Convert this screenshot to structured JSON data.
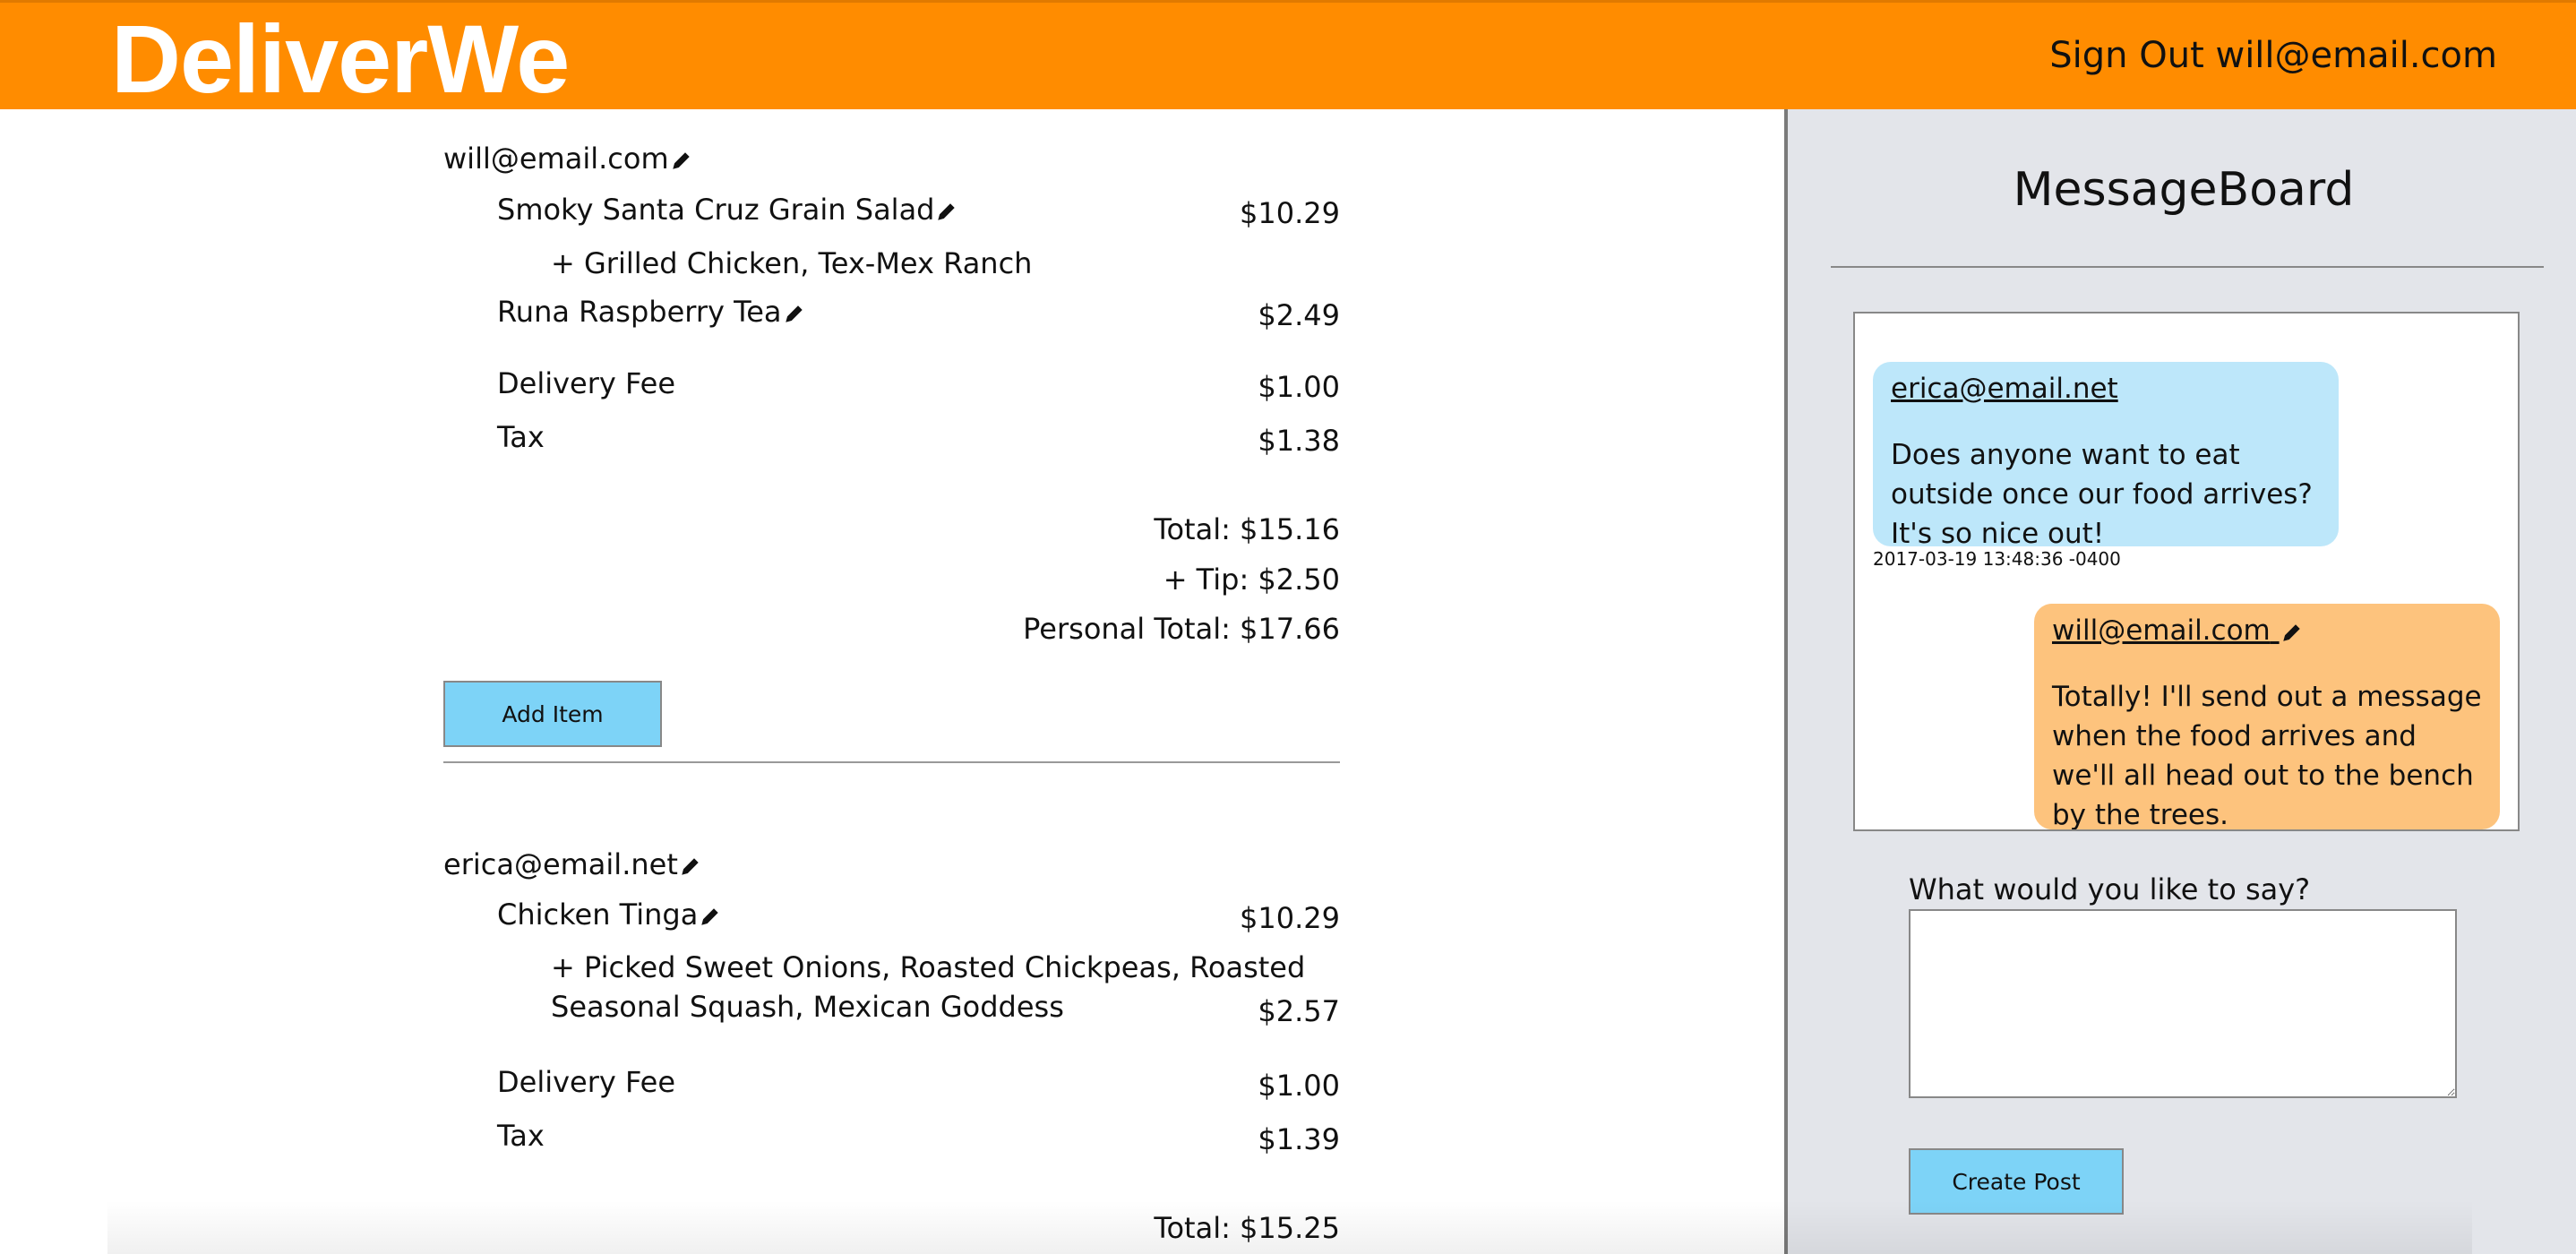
{
  "header": {
    "logo": "DeliverWe",
    "signout_label": "Sign Out will@email.com"
  },
  "orders": [
    {
      "user": "will@email.com",
      "items": [
        {
          "name": "Smoky Santa Cruz Grain Salad",
          "price": "$10.29",
          "mods": "+ Grilled Chicken, Tex-Mex Ranch"
        },
        {
          "name": "Runa Raspberry Tea",
          "price": "$2.49"
        }
      ],
      "delivery_label": "Delivery Fee",
      "delivery_fee": "$1.00",
      "tax_label": "Tax",
      "tax": "$1.38",
      "total": "Total: $15.16",
      "tip": "+ Tip: $2.50",
      "personal_total": "Personal Total: $17.66",
      "add_item_label": "Add Item"
    },
    {
      "user": "erica@email.net",
      "items": [
        {
          "name": "Chicken Tinga",
          "price": "$10.29",
          "mods_line1": "+ Picked Sweet Onions, Roasted Chickpeas, Roasted",
          "mods_line2": "Seasonal Squash, Mexican Goddess",
          "mods_price": "$2.57"
        }
      ],
      "delivery_label": "Delivery Fee",
      "delivery_fee": "$1.00",
      "tax_label": "Tax",
      "tax": "$1.39",
      "total": "Total: $15.25"
    }
  ],
  "board": {
    "title": "MessageBoard",
    "messages": [
      {
        "author": "erica@email.net",
        "text": "Does anyone want to eat outside once our food arrives? It's so nice out!",
        "timestamp": "2017-03-19 13:48:36 -0400"
      },
      {
        "author": "will@email.com",
        "text": "Totally! I'll send out a message when the food arrives and we'll all head out to the bench by the trees."
      }
    ],
    "prompt": "What would you like to say?",
    "input_value": "",
    "create_post_label": "Create Post"
  },
  "colors": {
    "header": "#ff8c00",
    "button": "#7dd3f7",
    "bubble_other": "#bde7fa",
    "bubble_self": "#fdc37d",
    "board_bg": "#e3e5ea"
  },
  "icons": [
    "pencil-icon"
  ]
}
